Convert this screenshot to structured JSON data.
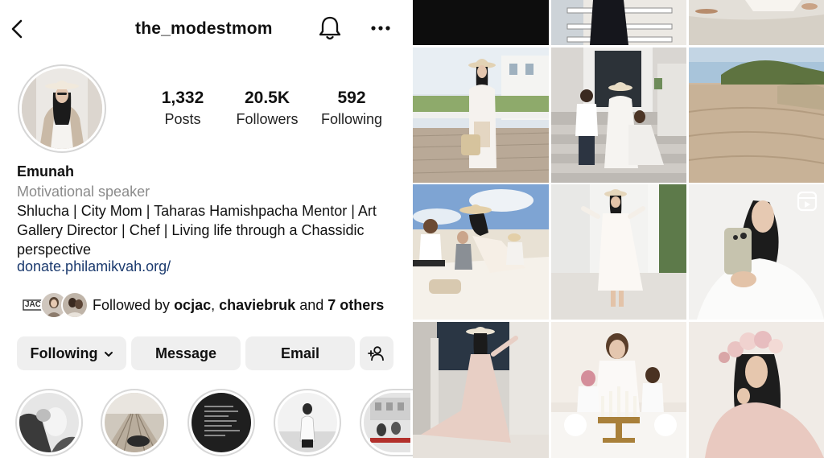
{
  "header": {
    "username": "the_modestmom",
    "back_icon": "chevron-left-icon",
    "bell_icon": "bell-icon",
    "more_icon": "more-horizontal-icon"
  },
  "stats": {
    "posts_count": "1,332",
    "posts_label": "Posts",
    "followers_count": "20.5K",
    "followers_label": "Followers",
    "following_count": "592",
    "following_label": "Following"
  },
  "bio": {
    "name": "Emunah",
    "category": "Motivational speaker",
    "text": "Shlucha | City Mom | Taharas Hamishpacha Mentor | Art Gallery Director | Chef | Living life through a Chassidic perspective",
    "link": "donate.philamikvah.org/"
  },
  "followed_by": {
    "prefix": "Followed by",
    "user1": "ocjac",
    "separator": ",",
    "user2": "chaviebruk",
    "connector": "and",
    "others": "7 others",
    "avatar1_text": "JAC"
  },
  "actions": {
    "following_label": "Following",
    "message_label": "Message",
    "email_label": "Email",
    "add_person_icon": "add-person-icon"
  },
  "colors": {
    "link": "#1b3a6e",
    "button_bg": "#efefef",
    "secondary_text": "#8a8a8a"
  },
  "grid": {
    "reels_icon": "reels-icon"
  }
}
